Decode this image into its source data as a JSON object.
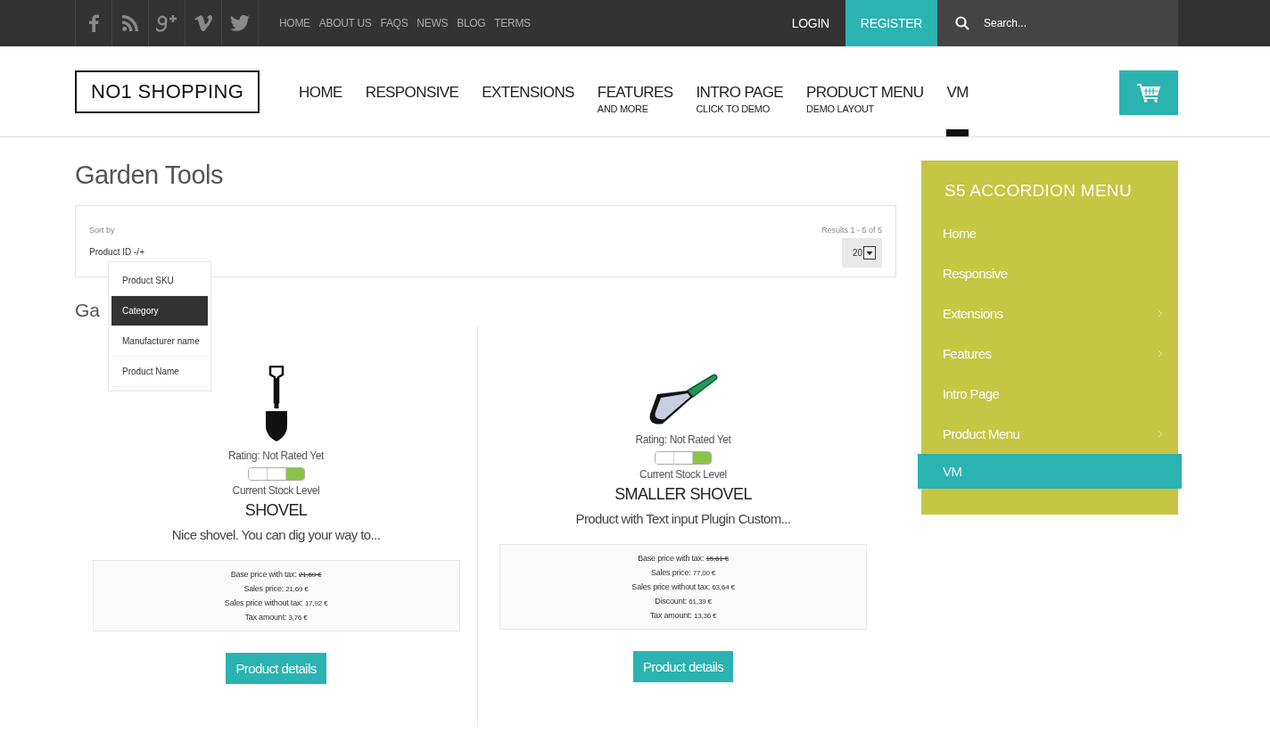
{
  "topbar": {
    "social": [
      {
        "kind": "facebook"
      },
      {
        "kind": "rss"
      },
      {
        "kind": "googleplus"
      },
      {
        "kind": "vimeo"
      },
      {
        "kind": "twitter"
      }
    ],
    "links": [
      "HOME",
      "ABOUT US",
      "FAQS",
      "NEWS",
      "BLOG",
      "TERMS"
    ],
    "login": "LOGIN",
    "register": "REGISTER",
    "search": {
      "placeholder": "Search..."
    }
  },
  "header": {
    "logo": "NO1 SHOPPING",
    "nav": [
      {
        "label": "HOME",
        "selected": false
      },
      {
        "label": "RESPONSIVE",
        "selected": false
      },
      {
        "label": "EXTENSIONS",
        "selected": false
      },
      {
        "label": "FEATURES",
        "sub": "AND MORE",
        "selected": false
      },
      {
        "label": "INTRO PAGE",
        "sub": "CLICK TO DEMO",
        "selected": false
      },
      {
        "label": "PRODUCT MENU",
        "sub": "DEMO LAYOUT",
        "selected": false
      },
      {
        "label": "VM",
        "selected": true
      }
    ]
  },
  "page": {
    "title": "Garden Tools",
    "sort": {
      "label": "Sort by",
      "value": "Product ID -/+",
      "results": "Results 1 - 5 of 5",
      "per_page": "20",
      "options": [
        {
          "label": "Product SKU",
          "selected": false
        },
        {
          "label": "Category",
          "selected": true
        },
        {
          "label": "Manufacturer name",
          "selected": false
        },
        {
          "label": "Product Name",
          "selected": false
        }
      ]
    },
    "category_heading": "Ga",
    "products": [
      {
        "kind": "shovel",
        "rating": "Rating: Not Rated Yet",
        "level": 0.33,
        "stock_label": "Current Stock Level",
        "name": "SHOVEL",
        "description": "Nice shovel. You can dig your way to...",
        "prices": [
          {
            "label": "Base price with tax:",
            "value": "21,69 €",
            "struck": true
          },
          {
            "label": "Sales price:",
            "value": "21,69 €",
            "struck": false
          },
          {
            "label": "Sales price without tax:",
            "value": "17,92 €",
            "struck": false
          },
          {
            "label": "Tax amount:",
            "value": "3,76 €",
            "struck": false
          }
        ],
        "button": "Product details"
      },
      {
        "kind": "trowel",
        "rating": "Rating: Not Rated Yet",
        "level": 0.33,
        "stock_label": "Current Stock Level",
        "name": "SMALLER SHOVEL",
        "description": "Product with Text input Plugin Custom...",
        "prices": [
          {
            "label": "Base price with tax:",
            "value": "15,61 €",
            "struck": true
          },
          {
            "label": "Sales price:",
            "value": "77,00 €",
            "struck": false
          },
          {
            "label": "Sales price without tax:",
            "value": "63,64 €",
            "struck": false
          },
          {
            "label": "Discount:",
            "value": "61,39 €",
            "struck": false
          },
          {
            "label": "Tax amount:",
            "value": "13,36 €",
            "struck": false
          }
        ],
        "button": "Product details"
      }
    ]
  },
  "sidebar": {
    "title": "S5 ACCORDION MENU",
    "items": [
      {
        "label": "Home",
        "has_children": false,
        "selected": false
      },
      {
        "label": "Responsive",
        "has_children": false,
        "selected": false
      },
      {
        "label": "Extensions",
        "has_children": true,
        "selected": false
      },
      {
        "label": "Features",
        "has_children": true,
        "selected": false
      },
      {
        "label": "Intro Page",
        "has_children": false,
        "selected": false
      },
      {
        "label": "Product Menu",
        "has_children": true,
        "selected": false
      },
      {
        "label": "VM",
        "has_children": false,
        "selected": true
      }
    ]
  }
}
